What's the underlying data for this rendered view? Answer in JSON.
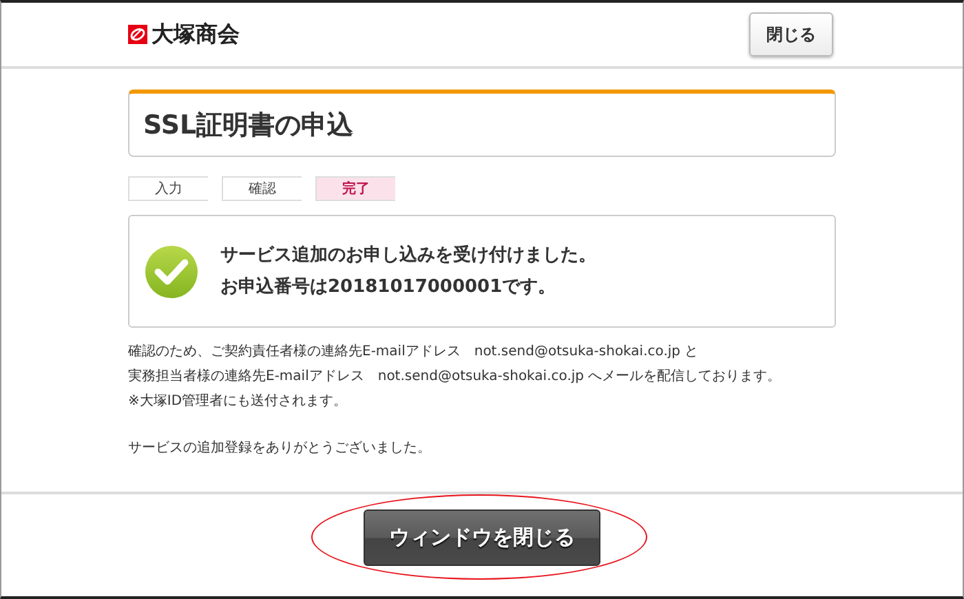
{
  "header": {
    "logo_text": "大塚商会",
    "close_button": "閉じる"
  },
  "title": "SSL証明書の申込",
  "steps": [
    {
      "label": "入力",
      "selected": false
    },
    {
      "label": "確認",
      "selected": false
    },
    {
      "label": "完了",
      "selected": true
    }
  ],
  "message": {
    "lines": [
      "サービス追加のお申し込みを受け付けました。",
      "お申込番号は20181017000001です。"
    ]
  },
  "notes": [
    "確認のため、ご契約責任者様の連絡先E-mailアドレス　not.send@otsuka-shokai.co.jp と",
    "実務担当者様の連絡先E-mailアドレス　not.send@otsuka-shokai.co.jp へメールを配信しております。",
    "※大塚ID管理者にも送付されます。"
  ],
  "thanks": "サービスの追加登録をありがとうございました。",
  "footer": {
    "button": "ウィンドウを閉じる",
    "highlighted": true
  }
}
